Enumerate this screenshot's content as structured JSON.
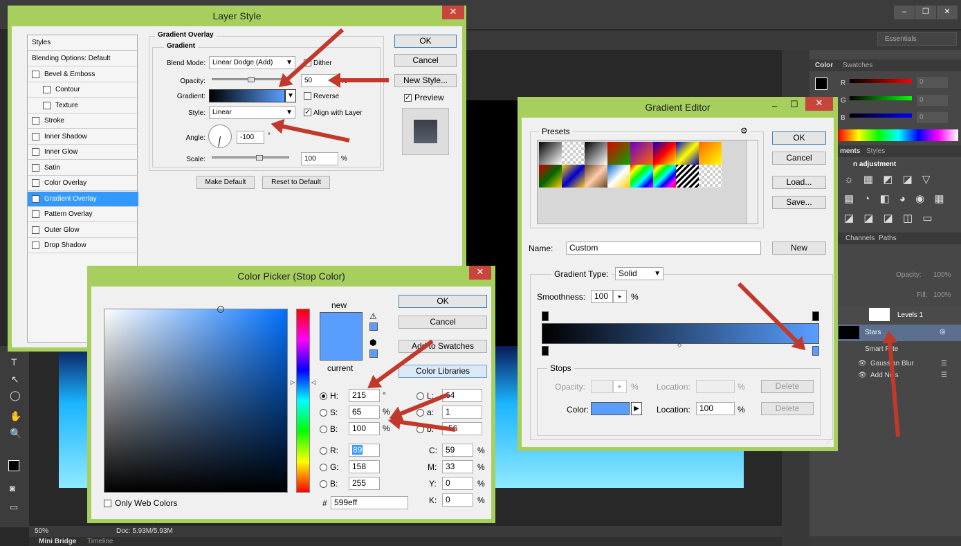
{
  "ps": {
    "workspace": "Essentials",
    "status_zoom": "50%",
    "status_doc": "Doc: 5.93M/5.93M",
    "bottom_tabs": [
      "Mini Bridge",
      "Timeline"
    ],
    "color_panel": {
      "tabs": [
        "Color",
        "Swatches"
      ],
      "r": "0",
      "g": "0",
      "b": "0"
    },
    "adj_panel": {
      "tabs": [
        "ments",
        "Styles"
      ],
      "title": "n adjustment"
    },
    "layers_panel": {
      "tabs": [
        "Channels",
        "Paths"
      ],
      "opacity_label": "Opacity:",
      "opacity": "100%",
      "fill_label": "Fill:",
      "fill": "100%"
    },
    "layers": [
      {
        "name": "Levels 1"
      },
      {
        "name": "Stars"
      },
      {
        "name": "Smart Filte"
      },
      {
        "name": "Gaussian Blur"
      },
      {
        "name": "Add Nois"
      }
    ]
  },
  "layer_style": {
    "title": "Layer Style",
    "styles_header": "Styles",
    "items": [
      {
        "label": "Blending Options: Default",
        "checkbox": false,
        "checked": false,
        "indent": false
      },
      {
        "label": "Bevel & Emboss",
        "checkbox": true,
        "checked": false,
        "indent": false
      },
      {
        "label": "Contour",
        "checkbox": true,
        "checked": false,
        "indent": true
      },
      {
        "label": "Texture",
        "checkbox": true,
        "checked": false,
        "indent": true
      },
      {
        "label": "Stroke",
        "checkbox": true,
        "checked": false,
        "indent": false
      },
      {
        "label": "Inner Shadow",
        "checkbox": true,
        "checked": false,
        "indent": false
      },
      {
        "label": "Inner Glow",
        "checkbox": true,
        "checked": false,
        "indent": false
      },
      {
        "label": "Satin",
        "checkbox": true,
        "checked": false,
        "indent": false
      },
      {
        "label": "Color Overlay",
        "checkbox": true,
        "checked": false,
        "indent": false
      },
      {
        "label": "Gradient Overlay",
        "checkbox": true,
        "checked": true,
        "indent": false,
        "selected": true
      },
      {
        "label": "Pattern Overlay",
        "checkbox": true,
        "checked": false,
        "indent": false
      },
      {
        "label": "Outer Glow",
        "checkbox": true,
        "checked": false,
        "indent": false
      },
      {
        "label": "Drop Shadow",
        "checkbox": true,
        "checked": false,
        "indent": false
      }
    ],
    "section_title": "Gradient Overlay",
    "subsection": "Gradient",
    "blend_mode_label": "Blend Mode:",
    "blend_mode": "Linear Dodge (Add)",
    "dither_label": "Dither",
    "opacity_label": "Opacity:",
    "opacity": "50",
    "gradient_label": "Gradient:",
    "reverse_label": "Reverse",
    "style_label": "Style:",
    "style": "Linear",
    "align_label": "Align with Layer",
    "angle_label": "Angle:",
    "angle": "-100",
    "deg": "°",
    "scale_label": "Scale:",
    "scale": "100",
    "pct": "%",
    "make_default": "Make Default",
    "reset_default": "Reset to Default",
    "ok": "OK",
    "cancel": "Cancel",
    "new_style": "New Style...",
    "preview_label": "Preview"
  },
  "gradient_editor": {
    "title": "Gradient Editor",
    "presets_label": "Presets",
    "ok": "OK",
    "cancel": "Cancel",
    "load": "Load...",
    "save": "Save...",
    "name_label": "Name:",
    "name": "Custom",
    "new": "New",
    "type_label": "Gradient Type:",
    "type": "Solid",
    "smooth_label": "Smoothness:",
    "smooth": "100",
    "pct": "%",
    "stops_label": "Stops",
    "opacity_label": "Opacity:",
    "location_label": "Location:",
    "delete": "Delete",
    "color_label": "Color:",
    "location": "100",
    "colors": {
      "start": "#000000",
      "end": "#599eff"
    }
  },
  "color_picker": {
    "title": "Color Picker (Stop Color)",
    "ok": "OK",
    "cancel": "Cancel",
    "add_swatches": "Add to Swatches",
    "libraries": "Color Libraries",
    "new_label": "new",
    "current_label": "current",
    "h_label": "H:",
    "h": "215",
    "h_unit": "°",
    "s_label": "S:",
    "s": "65",
    "s_unit": "%",
    "b_label": "B:",
    "b": "100",
    "b_unit": "%",
    "r_label": "R:",
    "r": "89",
    "g_label": "G:",
    "g": "158",
    "b2_label": "B:",
    "b2": "255",
    "l_label": "L:",
    "l": "64",
    "a_label": "a:",
    "a": "1",
    "bb_label": "b:",
    "bb": "-56",
    "c_label": "C:",
    "c": "59",
    "m_label": "M:",
    "m": "33",
    "y_label": "Y:",
    "y": "0",
    "k_label": "K:",
    "k": "0",
    "hash": "#",
    "hex": "599eff",
    "web_only": "Only Web Colors",
    "color": "#599eff"
  }
}
